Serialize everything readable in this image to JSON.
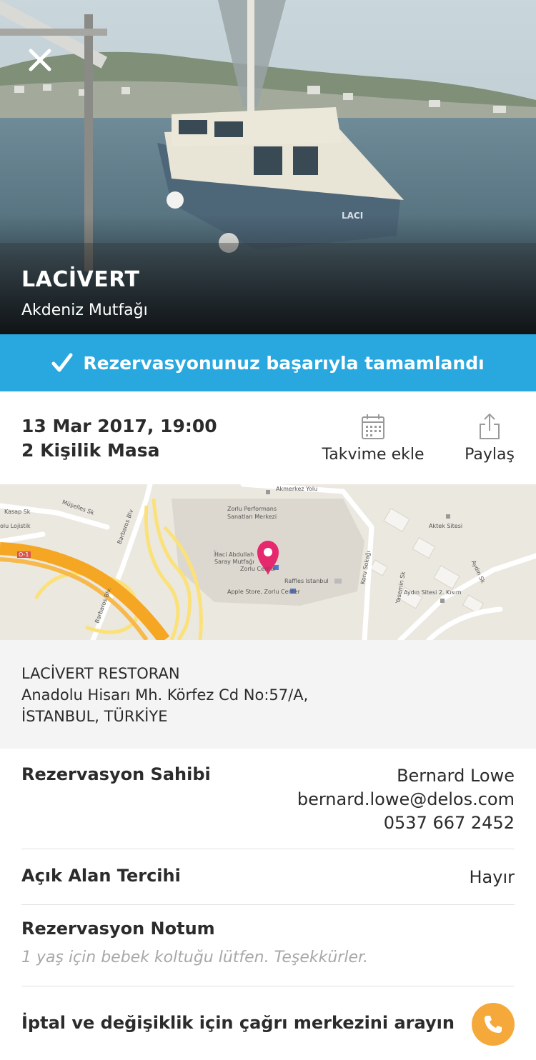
{
  "restaurant": {
    "name": "LACİVERT",
    "cuisine": "Akdeniz Mutfağı"
  },
  "banner": {
    "message": "Rezervasyonunuz başarıyla tamamlandı"
  },
  "reservation": {
    "datetime": "13 Mar 2017, 19:00",
    "table": "2 Kişilik Masa"
  },
  "actions": {
    "calendar_label": "Takvime ekle",
    "share_label": "Paylaş"
  },
  "map": {
    "labels": [
      "Akmerkez Yolu",
      "Zorlu Performans",
      "Sanatları Merkezi",
      "Haci Abdullah",
      "Saray Mutfağı",
      "Zorlu Center",
      "Raffles Istanbul",
      "Apple Store, Zorlu Center",
      "Aktek Sitesi",
      "Aydın Sitesi 2. Kısım",
      "Aydın Sk",
      "Koru Sokağı",
      "Yasemin Sk",
      "Barbaros Blv",
      "Barbaros Blv.",
      "Kasap Sk",
      "Müşelles Sk",
      "olu Lojistik",
      "O-1"
    ],
    "pin_color": "#e6286e",
    "road_color": "#f5a623"
  },
  "address": {
    "name": "LACİVERT RESTORAN",
    "street": "Anadolu Hisarı Mh. Körfez Cd No:57/A,",
    "city": "İSTANBUL, TÜRKİYE"
  },
  "owner": {
    "label": "Rezervasyon Sahibi",
    "name": "Bernard Lowe",
    "email": "bernard.lowe@delos.com",
    "phone": "0537 667 2452"
  },
  "outdoor": {
    "label": "Açık Alan Tercihi",
    "value": "Hayır"
  },
  "note": {
    "label": "Rezervasyon Notum",
    "text": "1 yaş için bebek koltuğu lütfen. Teşekkürler."
  },
  "call_center": {
    "label": "İptal ve değişiklik için çağrı merkezini arayın"
  },
  "colors": {
    "accent_blue": "#29a8e0",
    "call_orange": "#f6a93b"
  }
}
